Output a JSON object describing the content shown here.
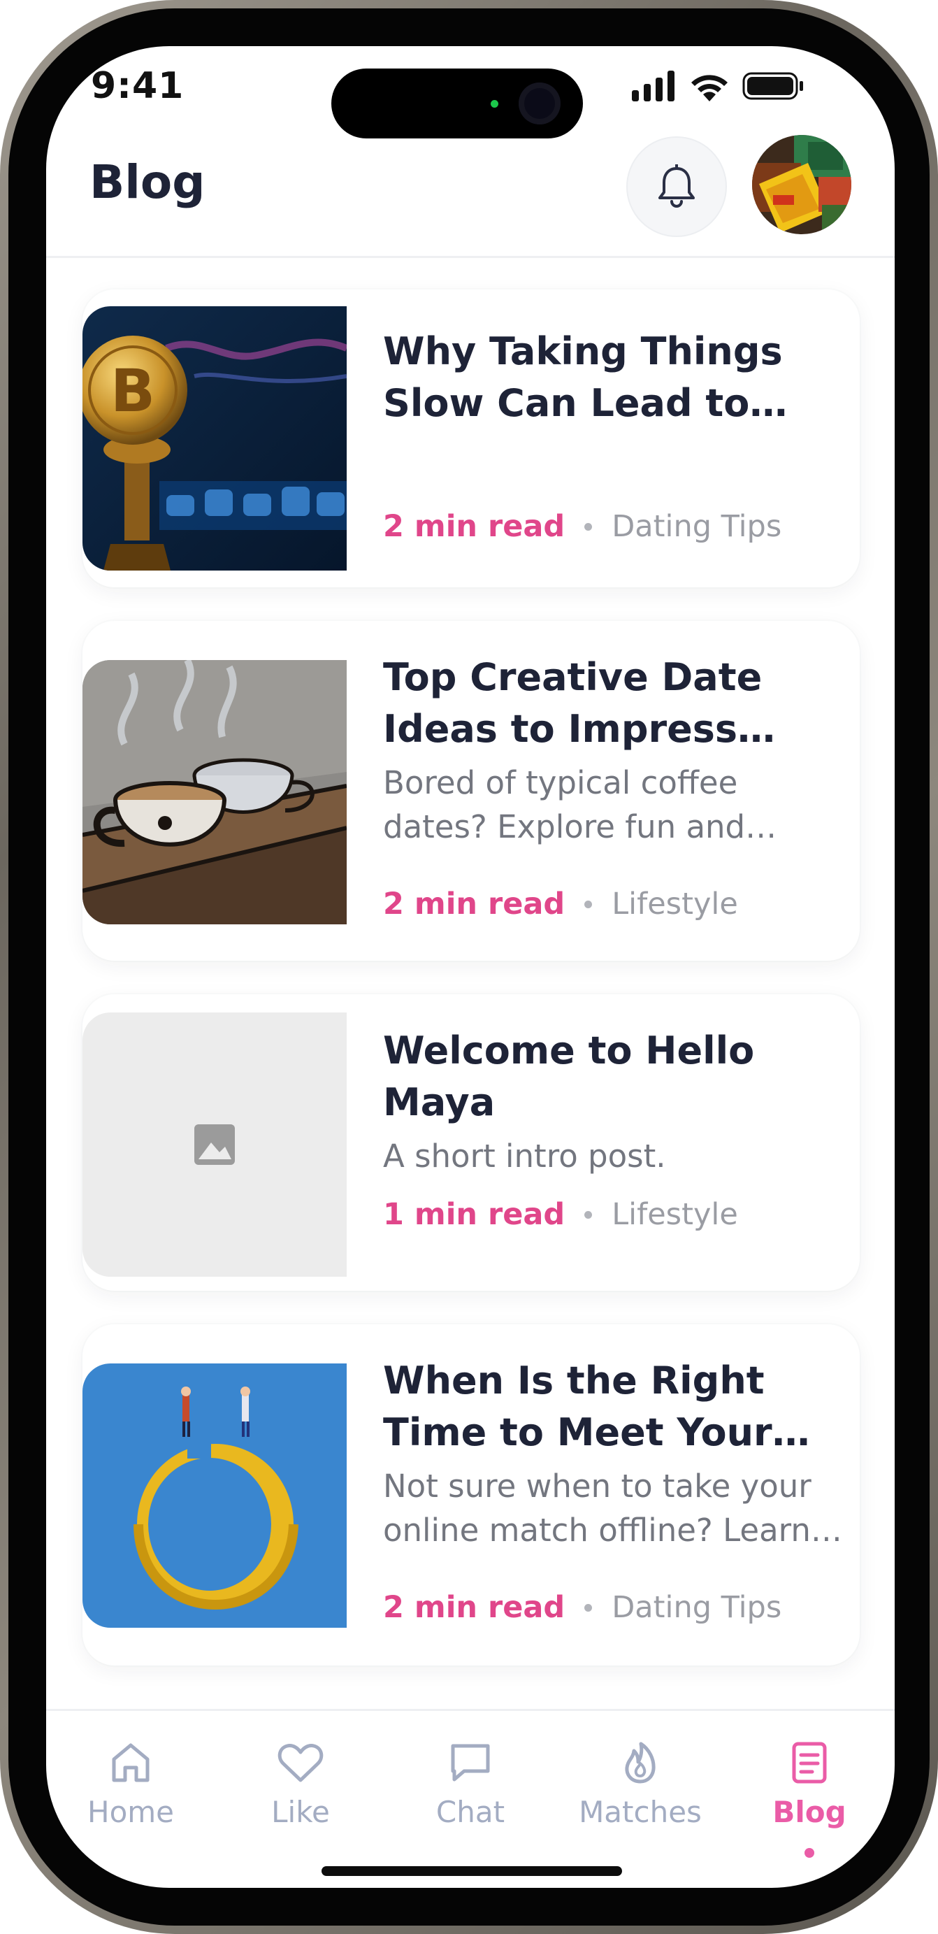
{
  "status_bar": {
    "time": "9:41"
  },
  "header": {
    "title": "Blog"
  },
  "posts": [
    {
      "title": "Why Taking Things Slow Can Lead to Better Relationships",
      "excerpt": "",
      "read_time": "2 min read",
      "category": "Dating Tips",
      "image": "bitcoin-coin-photo"
    },
    {
      "title": "Top Creative Date Ideas to Impress Your Match",
      "excerpt": "Bored of typical coffee dates? Explore fun and creative ideas",
      "read_time": "2 min read",
      "category": "Lifestyle",
      "image": "coffee-cups-drawing"
    },
    {
      "title": "Welcome to Hello Maya",
      "excerpt": "A short intro post.",
      "read_time": "1 min read",
      "category": "Lifestyle",
      "image": "image-placeholder-icon"
    },
    {
      "title": "When Is the Right Time to Meet Your Match",
      "excerpt": "Not sure when to take your online match offline? Learn more",
      "read_time": "2 min read",
      "category": "Dating Tips",
      "image": "ring-illustration"
    }
  ],
  "nav": {
    "items": [
      {
        "label": "Home",
        "icon": "home-icon"
      },
      {
        "label": "Like",
        "icon": "heart-icon"
      },
      {
        "label": "Chat",
        "icon": "chat-icon"
      },
      {
        "label": "Matches",
        "icon": "flame-icon"
      },
      {
        "label": "Blog",
        "icon": "blog-icon",
        "active": true
      }
    ]
  },
  "colors": {
    "accent": "#e0468a",
    "nav_active": "#ea5ca7",
    "nav_inactive": "#a3acc2",
    "title": "#1e2337"
  }
}
